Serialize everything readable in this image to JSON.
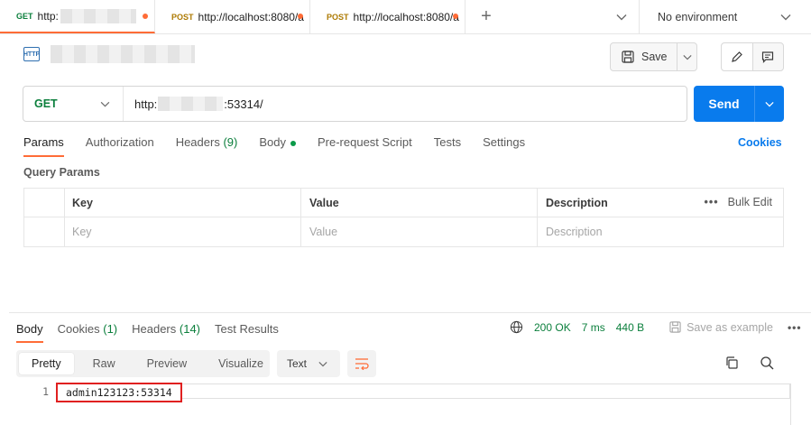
{
  "tabs": [
    {
      "method": "GET",
      "url": "http:",
      "active": true
    },
    {
      "method": "POST",
      "url": "http://localhost:8080/a",
      "active": false
    },
    {
      "method": "POST",
      "url": "http://localhost:8080/a",
      "active": false
    }
  ],
  "new_tab_symbol": "+",
  "environment": {
    "label": "No environment"
  },
  "request": {
    "method": "GET",
    "url_prefix": "http:",
    "url_suffix": ":53314/",
    "save_label": "Save",
    "send_label": "Send"
  },
  "request_tabs": [
    {
      "label": "Params",
      "active": true
    },
    {
      "label": "Authorization"
    },
    {
      "label": "Headers",
      "count": "(9)"
    },
    {
      "label": "Body",
      "dot": true
    },
    {
      "label": "Pre-request Script"
    },
    {
      "label": "Tests"
    },
    {
      "label": "Settings"
    }
  ],
  "cookies_label": "Cookies",
  "query_params": {
    "title": "Query Params",
    "headers": {
      "key": "Key",
      "value": "Value",
      "description": "Description"
    },
    "bulk_edit": "Bulk Edit",
    "placeholders": {
      "key": "Key",
      "value": "Value",
      "description": "Description"
    }
  },
  "response": {
    "tabs": [
      {
        "label": "Body",
        "active": true
      },
      {
        "label": "Cookies",
        "count": "(1)"
      },
      {
        "label": "Headers",
        "count": "(14)"
      },
      {
        "label": "Test Results"
      }
    ],
    "status": "200 OK",
    "time": "7 ms",
    "size": "440 B",
    "save_example": "Save as example",
    "view_modes": [
      "Pretty",
      "Raw",
      "Preview",
      "Visualize"
    ],
    "active_view": "Pretty",
    "format": "Text",
    "body_lines": [
      {
        "number": "1",
        "text": "admin123123:53314"
      }
    ]
  },
  "colors": {
    "accent": "#ff6c37",
    "send": "#097bed",
    "get": "#0b7f3c",
    "post": "#ad7a03",
    "highlight": "#e02020"
  }
}
